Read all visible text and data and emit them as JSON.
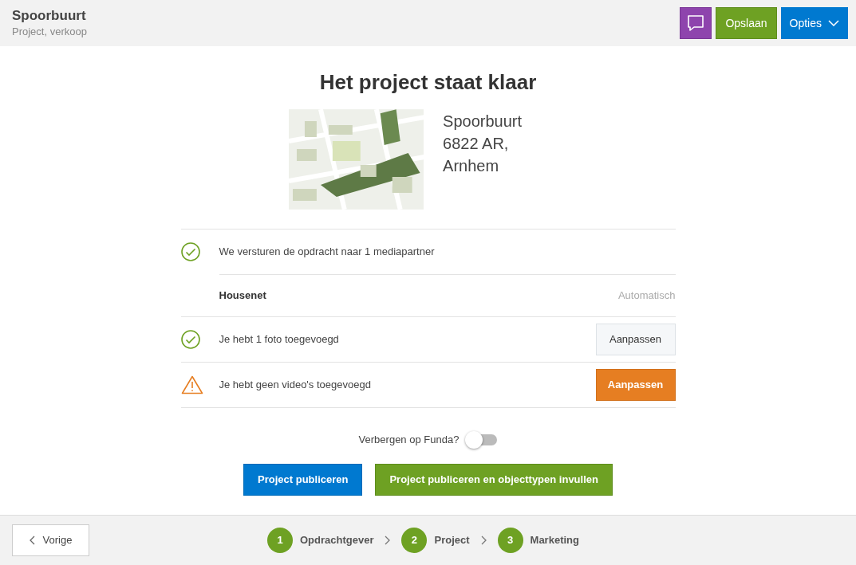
{
  "header": {
    "title": "Spoorbuurt",
    "subtitle": "Project, verkoop",
    "buttons": [
      {
        "kind": "chat"
      },
      {
        "kind": "save",
        "label": "Opslaan"
      },
      {
        "kind": "menu",
        "label": "Opties"
      }
    ]
  },
  "title": "Het project staat klaar",
  "project": {
    "name": "Spoorbuurt",
    "address": "6822 AR, Arnhem"
  },
  "checks": [
    {
      "kind": "ok",
      "text": "We versturen de opdracht naar 1 mediapartner",
      "partners": [
        {
          "name": "Housenet",
          "mode": "Automatisch"
        }
      ]
    },
    {
      "kind": "ok",
      "text": "Je hebt 1 foto toegevoegd",
      "action": "Aanpassen"
    },
    {
      "kind": "warning",
      "text": "Je hebt geen video's toegevoegd",
      "action": "Aanpassen"
    }
  ],
  "hide_toggle": {
    "label": "Verbergen op Funda?",
    "on": false
  },
  "actions": [
    {
      "kind": "blue",
      "label": "Project publiceren"
    },
    {
      "kind": "green",
      "label": "Project publiceren en objecttypen invullen"
    }
  ],
  "footer": {
    "back": "Vorige",
    "steps": [
      {
        "number": "1",
        "label": "Opdrachtgever"
      },
      {
        "number": "2",
        "label": "Project"
      },
      {
        "number": "3",
        "label": "Marketing"
      }
    ]
  }
}
